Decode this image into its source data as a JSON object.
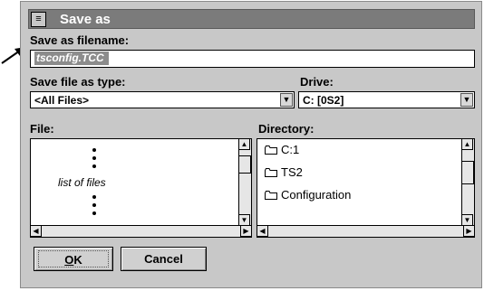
{
  "dialog": {
    "title": "Save as",
    "sysmenu_glyph": "≡"
  },
  "filename": {
    "label": "Save as filename:",
    "value": "tsconfig.TCC"
  },
  "filetype": {
    "label": "Save file as type:",
    "value": "<All Files>"
  },
  "drive": {
    "label": "Drive:",
    "value": "C:  [0S2]"
  },
  "file_list": {
    "label": "File:",
    "placeholder_text": "list of files"
  },
  "directory": {
    "label": "Directory:",
    "items": [
      "C:1",
      "TS2",
      "Configuration"
    ]
  },
  "buttons": {
    "ok_underlined": "O",
    "ok_rest": "K",
    "cancel": "Cancel"
  },
  "icons": {
    "pointer": "arrow-pointer-icon",
    "folder": "folder-icon",
    "dropdown": "chevron-down-icon"
  }
}
